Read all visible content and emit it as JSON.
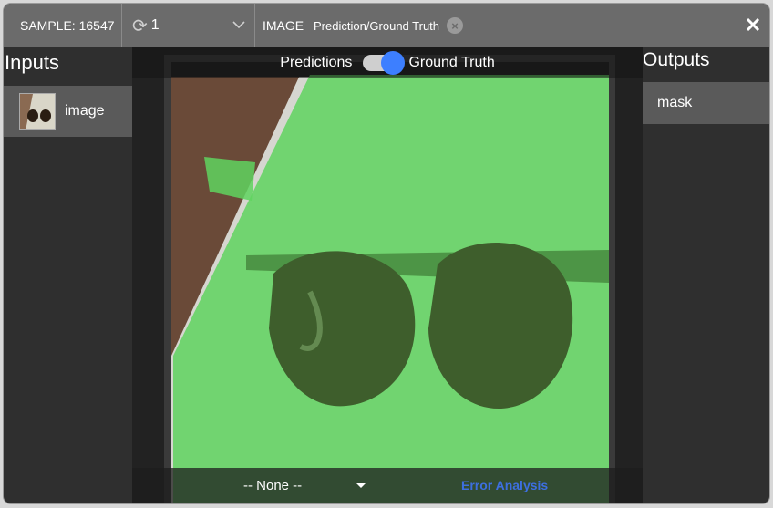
{
  "topbar": {
    "sample_label": "SAMPLE: 16547",
    "selector_value": "1",
    "image_label": "IMAGE",
    "chip_label": "Prediction/Ground Truth"
  },
  "inputs": {
    "title": "Inputs",
    "items": [
      {
        "label": "image"
      }
    ]
  },
  "outputs": {
    "title": "Outputs",
    "items": [
      {
        "label": "mask"
      }
    ]
  },
  "viewer": {
    "toggle_left": "Predictions",
    "toggle_right": "Ground Truth",
    "toggle_state": "Ground Truth",
    "select_value": "-- None --",
    "error_analysis": "Error Analysis"
  },
  "colors": {
    "accent": "#3d7fff",
    "mask_overlay": "#5fd45f"
  },
  "icons": [
    "refresh-icon",
    "chevron-down-icon",
    "close-chip-icon",
    "close-icon",
    "dropdown-caret-icon"
  ]
}
